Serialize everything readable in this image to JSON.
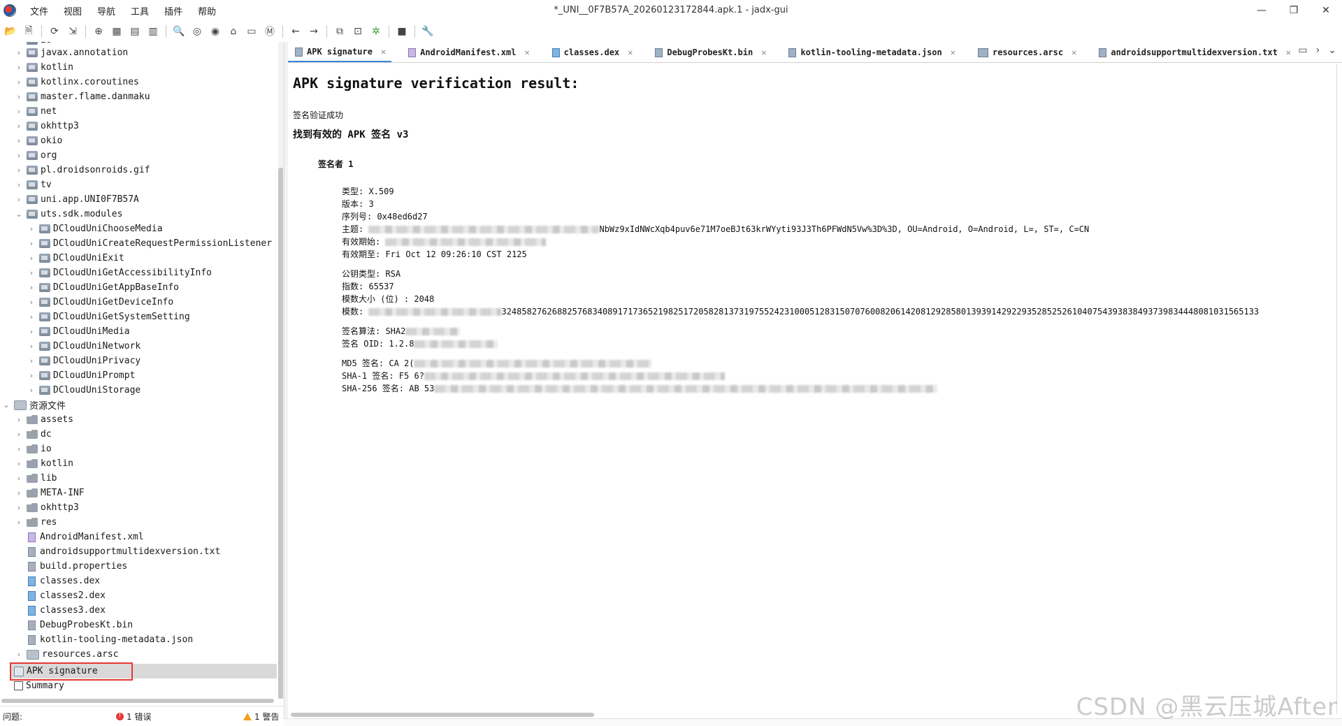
{
  "menu": [
    "文件",
    "视图",
    "导航",
    "工具",
    "插件",
    "帮助"
  ],
  "window_title": "*_UNI__0F7B57A_20260123172844.apk.1 - jadx-gui",
  "window_controls": {
    "minimize": "—",
    "maximize": "❐",
    "close": "✕"
  },
  "toolbar_icons": [
    "open-file-icon",
    "add-files-icon",
    "reload-icon",
    "export-icon",
    "sync-icon",
    "find-class-icon",
    "decompile-icon",
    "text-search-icon",
    "search-icon",
    "find-usage-icon",
    "goto-icon",
    "home-icon",
    "log-icon",
    "quark-icon",
    "back-icon",
    "forward-icon",
    "deobfuscation-icon",
    "flatten-icon",
    "debug-icon",
    "console-icon",
    "settings-icon"
  ],
  "tree": {
    "packages": [
      "io",
      "javax.annotation",
      "kotlin",
      "kotlinx.coroutines",
      "master.flame.danmaku",
      "net",
      "okhttp3",
      "okio",
      "org",
      "pl.droidsonroids.gif",
      "tv",
      "uni.app.UNI0F7B57A",
      "uts.sdk.modules"
    ],
    "uts_children": [
      "DCloudUniChooseMedia",
      "DCloudUniCreateRequestPermissionListener",
      "DCloudUniExit",
      "DCloudUniGetAccessibilityInfo",
      "DCloudUniGetAppBaseInfo",
      "DCloudUniGetDeviceInfo",
      "DCloudUniGetSystemSetting",
      "DCloudUniMedia",
      "DCloudUniNetwork",
      "DCloudUniPrivacy",
      "DCloudUniPrompt",
      "DCloudUniStorage"
    ],
    "resources_label": "资源文件",
    "resource_folders": [
      "assets",
      "dc",
      "io",
      "kotlin",
      "lib",
      "META-INF",
      "okhttp3",
      "res"
    ],
    "resource_files": [
      "AndroidManifest.xml",
      "androidsupportmultidexversion.txt",
      "build.properties",
      "classes.dex",
      "classes2.dex",
      "classes3.dex",
      "DebugProbesKt.bin",
      "kotlin-tooling-metadata.json",
      "resources.arsc"
    ],
    "apk_signature": "APK signature",
    "summary": "Summary"
  },
  "tabs": [
    "APK signature",
    "AndroidManifest.xml",
    "classes.dex",
    "DebugProbesKt.bin",
    "kotlin-tooling-metadata.json",
    "resources.arsc",
    "androidsupportmultidexversion.txt"
  ],
  "content": {
    "heading": "APK signature verification result:",
    "success": "签名验证成功",
    "found": "找到有效的 APK 签名 v3",
    "signer": "签名者 1",
    "type": "类型: X.509",
    "version": "版本: 3",
    "serial": "序列号: 0x48ed6d27",
    "subject_label": "主题:",
    "subject_tail": "NbWz9xIdNWcXqb4puv6e71M7oeBJt63krWYyti93J3Th6PFWdN5Vw%3D%3D, OU=Android, O=Android, L=, ST=, C=CN",
    "valid_from": "有效期始:",
    "valid_to": "有效期至: Fri Oct 12 09:26:10 CST 2125",
    "pubkey_type": "公钥类型: RSA",
    "exponent": "指数: 65537",
    "modulus_size": "模数大小 (位) : 2048",
    "modulus_label": "模数:",
    "modulus_tail": "324858276268825768340891717365219825172058281373197552423100051283150707600820614208129285801393914292293528525261040754393838493739834448081031565133",
    "sig_alg": "签名算法: SHA2",
    "sig_oid": "签名 OID: 1.2.8",
    "md5": "MD5 签名: CA 2(",
    "sha1": "SHA-1 签名: F5 6?",
    "sha256": "SHA-256 签名: AB 53"
  },
  "status": {
    "issues_label": "问题:",
    "errors": "1 错误",
    "warnings": "1 警告"
  },
  "watermark": "CSDN @黑云压城After"
}
